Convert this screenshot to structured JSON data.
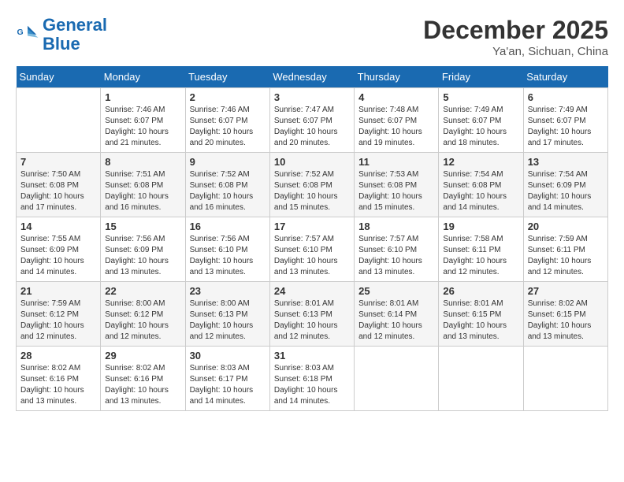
{
  "header": {
    "logo_line1": "General",
    "logo_line2": "Blue",
    "month_year": "December 2025",
    "location": "Ya'an, Sichuan, China"
  },
  "weekdays": [
    "Sunday",
    "Monday",
    "Tuesday",
    "Wednesday",
    "Thursday",
    "Friday",
    "Saturday"
  ],
  "weeks": [
    [
      {
        "day": "",
        "info": ""
      },
      {
        "day": "1",
        "info": "Sunrise: 7:46 AM\nSunset: 6:07 PM\nDaylight: 10 hours\nand 21 minutes."
      },
      {
        "day": "2",
        "info": "Sunrise: 7:46 AM\nSunset: 6:07 PM\nDaylight: 10 hours\nand 20 minutes."
      },
      {
        "day": "3",
        "info": "Sunrise: 7:47 AM\nSunset: 6:07 PM\nDaylight: 10 hours\nand 20 minutes."
      },
      {
        "day": "4",
        "info": "Sunrise: 7:48 AM\nSunset: 6:07 PM\nDaylight: 10 hours\nand 19 minutes."
      },
      {
        "day": "5",
        "info": "Sunrise: 7:49 AM\nSunset: 6:07 PM\nDaylight: 10 hours\nand 18 minutes."
      },
      {
        "day": "6",
        "info": "Sunrise: 7:49 AM\nSunset: 6:07 PM\nDaylight: 10 hours\nand 17 minutes."
      }
    ],
    [
      {
        "day": "7",
        "info": "Sunrise: 7:50 AM\nSunset: 6:08 PM\nDaylight: 10 hours\nand 17 minutes."
      },
      {
        "day": "8",
        "info": "Sunrise: 7:51 AM\nSunset: 6:08 PM\nDaylight: 10 hours\nand 16 minutes."
      },
      {
        "day": "9",
        "info": "Sunrise: 7:52 AM\nSunset: 6:08 PM\nDaylight: 10 hours\nand 16 minutes."
      },
      {
        "day": "10",
        "info": "Sunrise: 7:52 AM\nSunset: 6:08 PM\nDaylight: 10 hours\nand 15 minutes."
      },
      {
        "day": "11",
        "info": "Sunrise: 7:53 AM\nSunset: 6:08 PM\nDaylight: 10 hours\nand 15 minutes."
      },
      {
        "day": "12",
        "info": "Sunrise: 7:54 AM\nSunset: 6:08 PM\nDaylight: 10 hours\nand 14 minutes."
      },
      {
        "day": "13",
        "info": "Sunrise: 7:54 AM\nSunset: 6:09 PM\nDaylight: 10 hours\nand 14 minutes."
      }
    ],
    [
      {
        "day": "14",
        "info": "Sunrise: 7:55 AM\nSunset: 6:09 PM\nDaylight: 10 hours\nand 14 minutes."
      },
      {
        "day": "15",
        "info": "Sunrise: 7:56 AM\nSunset: 6:09 PM\nDaylight: 10 hours\nand 13 minutes."
      },
      {
        "day": "16",
        "info": "Sunrise: 7:56 AM\nSunset: 6:10 PM\nDaylight: 10 hours\nand 13 minutes."
      },
      {
        "day": "17",
        "info": "Sunrise: 7:57 AM\nSunset: 6:10 PM\nDaylight: 10 hours\nand 13 minutes."
      },
      {
        "day": "18",
        "info": "Sunrise: 7:57 AM\nSunset: 6:10 PM\nDaylight: 10 hours\nand 13 minutes."
      },
      {
        "day": "19",
        "info": "Sunrise: 7:58 AM\nSunset: 6:11 PM\nDaylight: 10 hours\nand 12 minutes."
      },
      {
        "day": "20",
        "info": "Sunrise: 7:59 AM\nSunset: 6:11 PM\nDaylight: 10 hours\nand 12 minutes."
      }
    ],
    [
      {
        "day": "21",
        "info": "Sunrise: 7:59 AM\nSunset: 6:12 PM\nDaylight: 10 hours\nand 12 minutes."
      },
      {
        "day": "22",
        "info": "Sunrise: 8:00 AM\nSunset: 6:12 PM\nDaylight: 10 hours\nand 12 minutes."
      },
      {
        "day": "23",
        "info": "Sunrise: 8:00 AM\nSunset: 6:13 PM\nDaylight: 10 hours\nand 12 minutes."
      },
      {
        "day": "24",
        "info": "Sunrise: 8:01 AM\nSunset: 6:13 PM\nDaylight: 10 hours\nand 12 minutes."
      },
      {
        "day": "25",
        "info": "Sunrise: 8:01 AM\nSunset: 6:14 PM\nDaylight: 10 hours\nand 12 minutes."
      },
      {
        "day": "26",
        "info": "Sunrise: 8:01 AM\nSunset: 6:15 PM\nDaylight: 10 hours\nand 13 minutes."
      },
      {
        "day": "27",
        "info": "Sunrise: 8:02 AM\nSunset: 6:15 PM\nDaylight: 10 hours\nand 13 minutes."
      }
    ],
    [
      {
        "day": "28",
        "info": "Sunrise: 8:02 AM\nSunset: 6:16 PM\nDaylight: 10 hours\nand 13 minutes."
      },
      {
        "day": "29",
        "info": "Sunrise: 8:02 AM\nSunset: 6:16 PM\nDaylight: 10 hours\nand 13 minutes."
      },
      {
        "day": "30",
        "info": "Sunrise: 8:03 AM\nSunset: 6:17 PM\nDaylight: 10 hours\nand 14 minutes."
      },
      {
        "day": "31",
        "info": "Sunrise: 8:03 AM\nSunset: 6:18 PM\nDaylight: 10 hours\nand 14 minutes."
      },
      {
        "day": "",
        "info": ""
      },
      {
        "day": "",
        "info": ""
      },
      {
        "day": "",
        "info": ""
      }
    ]
  ]
}
